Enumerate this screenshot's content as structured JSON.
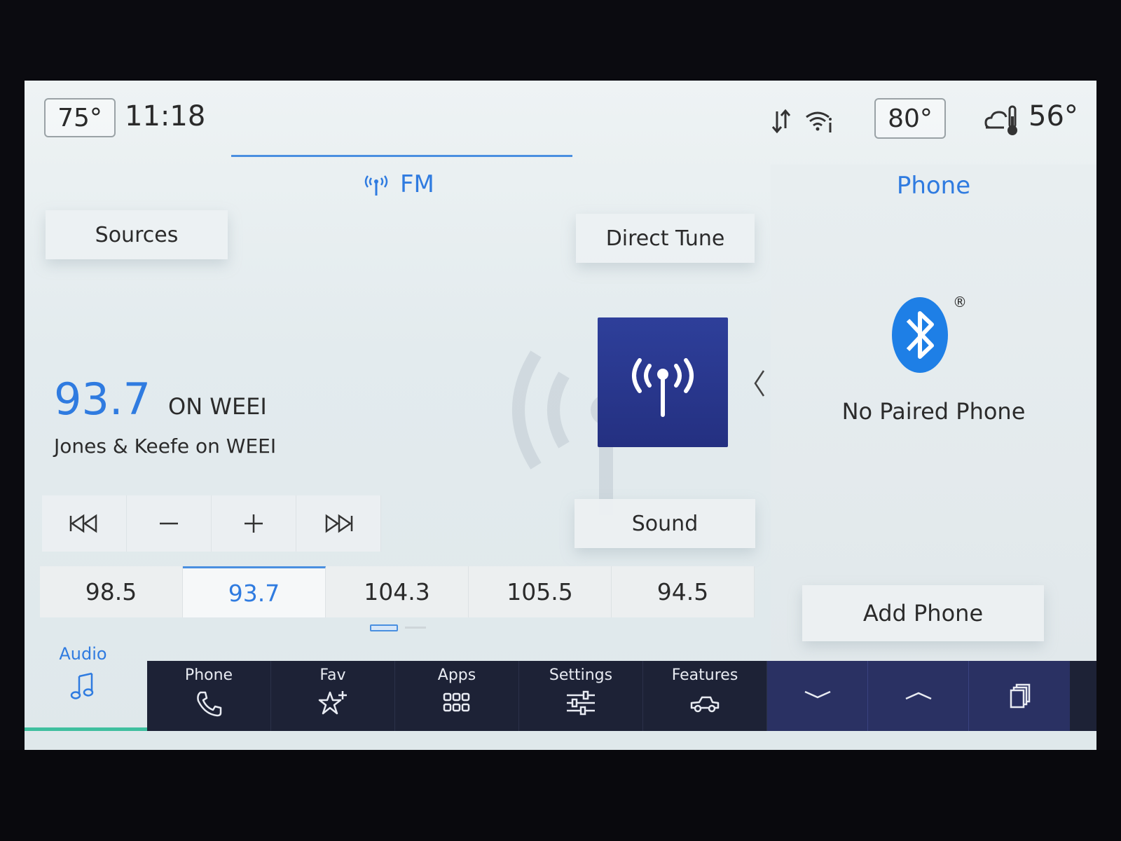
{
  "status": {
    "cabin_temp_left": "75°",
    "clock": "11:18",
    "cabin_temp_right": "80°",
    "outside_temp": "56°"
  },
  "audio": {
    "source_label": "FM",
    "sources_label": "Sources",
    "direct_tune_label": "Direct Tune",
    "frequency": "93.7",
    "station_name": "ON WEEI",
    "program": "Jones & Keefe on WEEI",
    "sound_label": "Sound",
    "presets": [
      "98.5",
      "93.7",
      "104.3",
      "105.5",
      "94.5"
    ],
    "active_preset_index": 1
  },
  "phone": {
    "title": "Phone",
    "status": "No Paired Phone",
    "add_phone_label": "Add Phone",
    "registered_mark": "®"
  },
  "nav": {
    "audio_label": "Audio",
    "items": [
      "Phone",
      "Fav",
      "Apps",
      "Settings",
      "Features"
    ]
  },
  "colors": {
    "accent": "#2f7be0",
    "nav_bg": "#1d2236",
    "station_art": "#2a378f",
    "audio_indicator": "#3fbf9f"
  },
  "icons": [
    "music-note-icon",
    "phone-handset-icon",
    "star-plus-icon",
    "apps-grid-icon",
    "settings-sliders-icon",
    "vehicle-icon",
    "bluetooth-icon",
    "radio-antenna-icon"
  ]
}
